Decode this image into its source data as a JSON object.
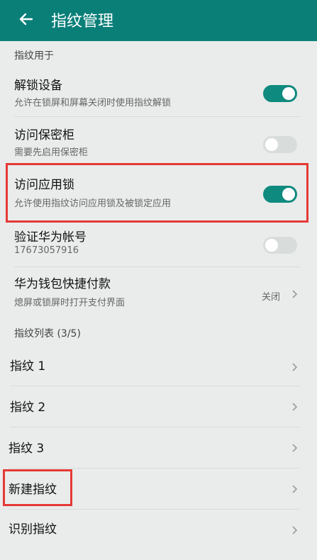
{
  "header": {
    "title": "指纹管理"
  },
  "section_usage": {
    "label": "指纹用于"
  },
  "rows": [
    {
      "title": "解锁设备",
      "subtitle": "允许在锁屏和屏幕关闭时使用指纹解锁",
      "toggle": "on"
    },
    {
      "title": "访问保密柜",
      "subtitle": "需要先启用保密柜",
      "toggle": "off"
    },
    {
      "title": "访问应用锁",
      "subtitle": "允许使用指纹访问应用锁及被锁定应用",
      "toggle": "on"
    },
    {
      "title": "验证华为帐号",
      "subtitle": "17673057916",
      "toggle": "off"
    },
    {
      "title": "华为钱包快捷付款",
      "subtitle": "熄屏或锁屏时打开支付界面",
      "value": "关闭"
    }
  ],
  "section_list": {
    "label": "指纹列表 (3/5)"
  },
  "fingerprints": [
    {
      "label": "指纹 1"
    },
    {
      "label": "指纹 2"
    },
    {
      "label": "指纹 3"
    },
    {
      "label": "新建指纹"
    },
    {
      "label": "识别指纹"
    }
  ],
  "colors": {
    "header": "#0a7f78",
    "toggle_on": "#0f8a7e",
    "toggle_off": "#d8dcdb",
    "highlight": "#e53935"
  }
}
